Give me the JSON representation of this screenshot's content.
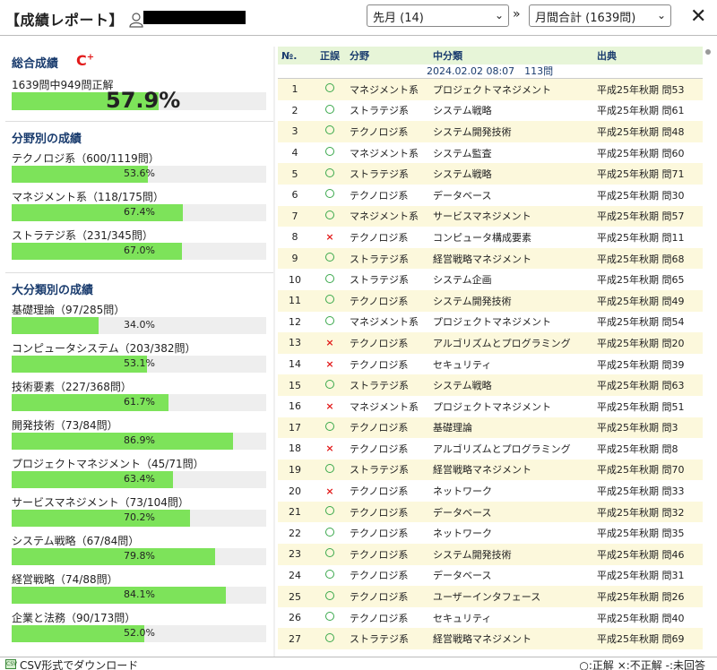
{
  "header": {
    "title": "【成績レポート】",
    "month_select": "先月 (14)",
    "agg_select": "月間合計 (1639問)",
    "close": "✕"
  },
  "overall": {
    "title": "総合成績",
    "grade": "C",
    "grade_sup": "+",
    "summary": "1639問中949問正解",
    "pct": "57.9%",
    "pct_value": 57.9
  },
  "field_section": {
    "title": "分野別の成績",
    "items": [
      {
        "label": "テクノロジ系（600/1119問）",
        "pct": "53.6%",
        "value": 53.6
      },
      {
        "label": "マネジメント系（118/175問）",
        "pct": "67.4%",
        "value": 67.4
      },
      {
        "label": "ストラテジ系（231/345問）",
        "pct": "67.0%",
        "value": 67.0
      }
    ]
  },
  "major_section": {
    "title": "大分類別の成績",
    "items": [
      {
        "label": "基礎理論（97/285問）",
        "pct": "34.0%",
        "value": 34.0
      },
      {
        "label": "コンピュータシステム（203/382問）",
        "pct": "53.1%",
        "value": 53.1
      },
      {
        "label": "技術要素（227/368問）",
        "pct": "61.7%",
        "value": 61.7
      },
      {
        "label": "開発技術（73/84問）",
        "pct": "86.9%",
        "value": 86.9
      },
      {
        "label": "プロジェクトマネジメント（45/71問）",
        "pct": "63.4%",
        "value": 63.4
      },
      {
        "label": "サービスマネジメント（73/104問）",
        "pct": "70.2%",
        "value": 70.2
      },
      {
        "label": "システム戦略（67/84問）",
        "pct": "79.8%",
        "value": 79.8
      },
      {
        "label": "経営戦略（74/88問）",
        "pct": "84.1%",
        "value": 84.1
      },
      {
        "label": "企業と法務（90/173問）",
        "pct": "52.0%",
        "value": 52.0
      }
    ]
  },
  "table": {
    "headers": {
      "no": "№.",
      "ok": "正誤",
      "cat": "分野",
      "sub": "中分類",
      "src": "出典"
    },
    "date_label": "2024.02.02 08:07　113問",
    "rows": [
      {
        "no": "1",
        "ok": true,
        "cat": "マネジメント系",
        "sub": "プロジェクトマネジメント",
        "src": "平成25年秋期 問53"
      },
      {
        "no": "2",
        "ok": true,
        "cat": "ストラテジ系",
        "sub": "システム戦略",
        "src": "平成25年秋期 問61"
      },
      {
        "no": "3",
        "ok": true,
        "cat": "テクノロジ系",
        "sub": "システム開発技術",
        "src": "平成25年秋期 問48"
      },
      {
        "no": "4",
        "ok": true,
        "cat": "マネジメント系",
        "sub": "システム監査",
        "src": "平成25年秋期 問60"
      },
      {
        "no": "5",
        "ok": true,
        "cat": "ストラテジ系",
        "sub": "システム戦略",
        "src": "平成25年秋期 問71"
      },
      {
        "no": "6",
        "ok": true,
        "cat": "テクノロジ系",
        "sub": "データベース",
        "src": "平成25年秋期 問30"
      },
      {
        "no": "7",
        "ok": true,
        "cat": "マネジメント系",
        "sub": "サービスマネジメント",
        "src": "平成25年秋期 問57"
      },
      {
        "no": "8",
        "ok": false,
        "cat": "テクノロジ系",
        "sub": "コンピュータ構成要素",
        "src": "平成25年秋期 問11"
      },
      {
        "no": "9",
        "ok": true,
        "cat": "ストラテジ系",
        "sub": "経営戦略マネジメント",
        "src": "平成25年秋期 問68"
      },
      {
        "no": "10",
        "ok": true,
        "cat": "ストラテジ系",
        "sub": "システム企画",
        "src": "平成25年秋期 問65"
      },
      {
        "no": "11",
        "ok": true,
        "cat": "テクノロジ系",
        "sub": "システム開発技術",
        "src": "平成25年秋期 問49"
      },
      {
        "no": "12",
        "ok": true,
        "cat": "マネジメント系",
        "sub": "プロジェクトマネジメント",
        "src": "平成25年秋期 問54"
      },
      {
        "no": "13",
        "ok": false,
        "cat": "テクノロジ系",
        "sub": "アルゴリズムとプログラミング",
        "src": "平成25年秋期 問20"
      },
      {
        "no": "14",
        "ok": false,
        "cat": "テクノロジ系",
        "sub": "セキュリティ",
        "src": "平成25年秋期 問39"
      },
      {
        "no": "15",
        "ok": true,
        "cat": "ストラテジ系",
        "sub": "システム戦略",
        "src": "平成25年秋期 問63"
      },
      {
        "no": "16",
        "ok": false,
        "cat": "マネジメント系",
        "sub": "プロジェクトマネジメント",
        "src": "平成25年秋期 問51"
      },
      {
        "no": "17",
        "ok": true,
        "cat": "テクノロジ系",
        "sub": "基礎理論",
        "src": "平成25年秋期 問3"
      },
      {
        "no": "18",
        "ok": false,
        "cat": "テクノロジ系",
        "sub": "アルゴリズムとプログラミング",
        "src": "平成25年秋期 問8"
      },
      {
        "no": "19",
        "ok": true,
        "cat": "ストラテジ系",
        "sub": "経営戦略マネジメント",
        "src": "平成25年秋期 問70"
      },
      {
        "no": "20",
        "ok": false,
        "cat": "テクノロジ系",
        "sub": "ネットワーク",
        "src": "平成25年秋期 問33"
      },
      {
        "no": "21",
        "ok": true,
        "cat": "テクノロジ系",
        "sub": "データベース",
        "src": "平成25年秋期 問32"
      },
      {
        "no": "22",
        "ok": true,
        "cat": "テクノロジ系",
        "sub": "ネットワーク",
        "src": "平成25年秋期 問35"
      },
      {
        "no": "23",
        "ok": true,
        "cat": "テクノロジ系",
        "sub": "システム開発技術",
        "src": "平成25年秋期 問46"
      },
      {
        "no": "24",
        "ok": true,
        "cat": "テクノロジ系",
        "sub": "データベース",
        "src": "平成25年秋期 問31"
      },
      {
        "no": "25",
        "ok": true,
        "cat": "テクノロジ系",
        "sub": "ユーザーインタフェース",
        "src": "平成25年秋期 問26"
      },
      {
        "no": "26",
        "ok": true,
        "cat": "テクノロジ系",
        "sub": "セキュリティ",
        "src": "平成25年秋期 問40"
      },
      {
        "no": "27",
        "ok": true,
        "cat": "ストラテジ系",
        "sub": "経営戦略マネジメント",
        "src": "平成25年秋期 問69"
      }
    ]
  },
  "footer": {
    "csv_label": "CSV形式でダウンロード",
    "csv_icon": "CSV",
    "legend": "○:正解 ×:不正解 -:未回答"
  },
  "colors": {
    "bar_fill": "#7de35a",
    "grade": "#e21b1b",
    "section_title": "#1a3c6e",
    "row_alt": "#fcf8dc",
    "table_head": "#e7f5d8"
  }
}
